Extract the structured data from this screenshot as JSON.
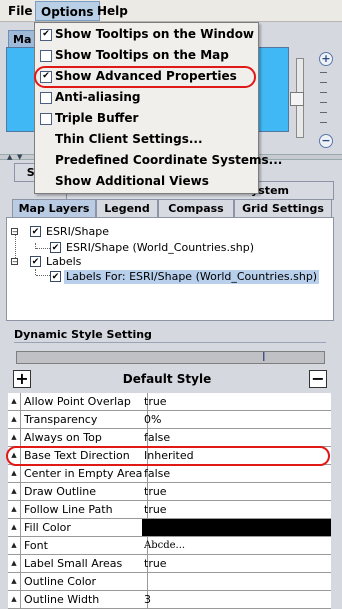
{
  "menubar": {
    "file": "File",
    "options": "Options",
    "help": "Help"
  },
  "map_panel": {
    "tab_label": "Ma",
    "zoom_in": "+",
    "zoom_out": "−"
  },
  "options_menu": {
    "items": [
      {
        "label": "Show Tooltips on the Window",
        "checkbox": true,
        "checked": true
      },
      {
        "label": "Show Tooltips on the Map",
        "checkbox": true,
        "checked": false
      },
      {
        "label": "Show Advanced Properties",
        "checkbox": true,
        "checked": true
      },
      {
        "label": "Anti-aliasing",
        "checkbox": true,
        "checked": false
      },
      {
        "label": "Triple Buffer",
        "checkbox": true,
        "checked": false
      },
      {
        "label": "Thin Client Settings...",
        "checkbox": false
      },
      {
        "label": "Predefined Coordinate Systems...",
        "checkbox": false
      },
      {
        "label": "Show Additional Views",
        "checkbox": false
      }
    ]
  },
  "tabs": {
    "back_row": [
      "Sym",
      "ystem"
    ],
    "front_row": [
      "Map Layers",
      "Legend",
      "Compass",
      "Grid Settings"
    ],
    "selected": "Map Layers"
  },
  "tree": {
    "nodes": [
      {
        "label": "ESRI/Shape",
        "checked": true
      },
      {
        "label": "ESRI/Shape (World_Countries.shp)",
        "checked": true
      },
      {
        "label": "Labels",
        "checked": true
      },
      {
        "label": "Labels For: ESRI/Shape (World_Countries.shp)",
        "checked": true,
        "selected": true
      }
    ]
  },
  "dynamic_style": {
    "title": "Dynamic Style Setting",
    "add_button": "+",
    "remove_button": "−",
    "style_name": "Default Style",
    "marker_icon": "I-beam-marker-icon"
  },
  "properties": [
    {
      "name": "Allow Point Overlap",
      "value": "true"
    },
    {
      "name": "Transparency",
      "value": "0%"
    },
    {
      "name": "Always on Top",
      "value": "false"
    },
    {
      "name": "Base Text Direction",
      "value": "Inherited"
    },
    {
      "name": "Center in Empty Area",
      "value": "false"
    },
    {
      "name": "Draw Outline",
      "value": "true"
    },
    {
      "name": "Follow Line Path",
      "value": "true"
    },
    {
      "name": "Fill Color",
      "value": "",
      "swatch": "#000000"
    },
    {
      "name": "Font",
      "value": "Abcde..."
    },
    {
      "name": "Label Small Areas",
      "value": "true"
    },
    {
      "name": "Outline Color",
      "value": ""
    },
    {
      "name": "Outline Width",
      "value": "3"
    }
  ],
  "colors": {
    "map_background": "#40b8f5",
    "highlight_oval": "#e01818",
    "selection": "#b9d0ec"
  }
}
